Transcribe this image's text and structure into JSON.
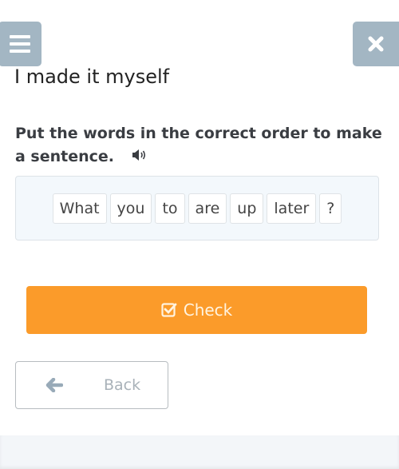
{
  "header": {
    "menu_icon": "hamburger-menu-icon",
    "close_icon": "close-x-icon",
    "title": "I made it myself"
  },
  "exercise": {
    "instruction": "Put the words in the correct order to make a sentence.",
    "audio_icon": "speaker-icon",
    "words": [
      "What",
      "you",
      "to",
      "are",
      "up",
      "later",
      "?"
    ]
  },
  "actions": {
    "check_label": "Check",
    "check_icon": "checkbox-check-icon",
    "back_label": "Back",
    "back_icon": "arrow-left-icon"
  },
  "colors": {
    "header_button": "#a3b6c3",
    "check_button": "#fb9b2a",
    "answer_box_bg": "#f3f8fc"
  }
}
